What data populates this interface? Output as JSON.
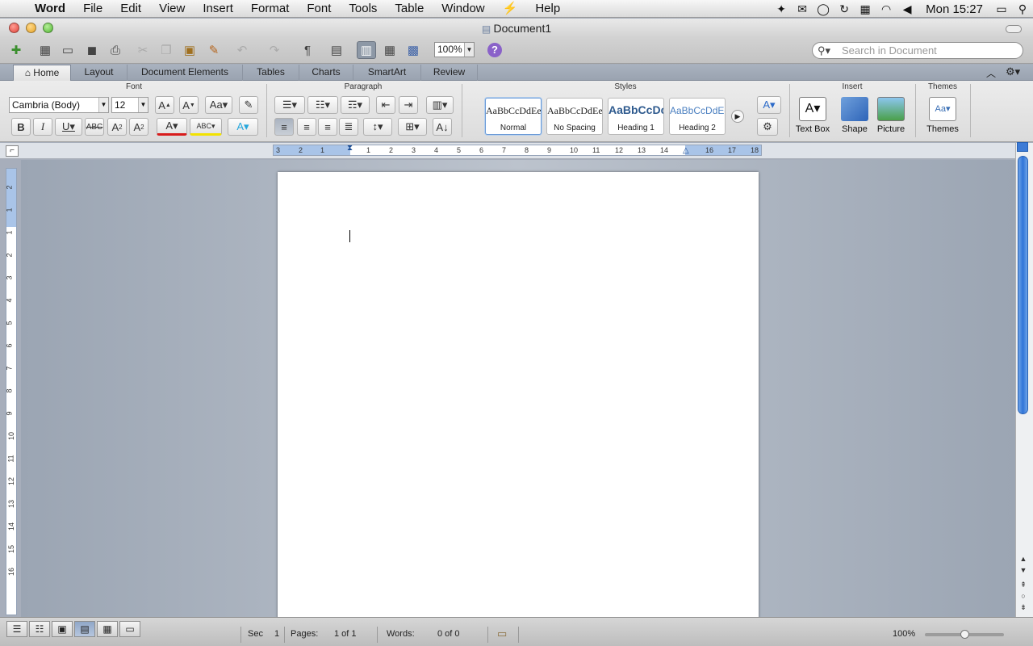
{
  "menubar": {
    "apple": "",
    "app": "Word",
    "items": [
      "File",
      "Edit",
      "View",
      "Insert",
      "Format",
      "Font",
      "Tools",
      "Table",
      "Window",
      "⚡",
      "Help"
    ],
    "clock": "Mon 15:27"
  },
  "window": {
    "title": "Document1"
  },
  "toolbar": {
    "zoom": "100%",
    "help": "?",
    "search_placeholder": "Search in Document"
  },
  "tabs": [
    "Home",
    "Layout",
    "Document Elements",
    "Tables",
    "Charts",
    "SmartArt",
    "Review"
  ],
  "ribbon": {
    "font": {
      "title": "Font",
      "name": "Cambria (Body)",
      "size": "12"
    },
    "paragraph": {
      "title": "Paragraph"
    },
    "styles": {
      "title": "Styles",
      "items": [
        {
          "preview": "AaBbCcDdEe",
          "name": "Normal"
        },
        {
          "preview": "AaBbCcDdEe",
          "name": "No Spacing"
        },
        {
          "preview": "AaBbCcDc",
          "name": "Heading 1"
        },
        {
          "preview": "AaBbCcDdEe",
          "name": "Heading 2"
        }
      ]
    },
    "insert": {
      "title": "Insert",
      "items": [
        "Text Box",
        "Shape",
        "Picture"
      ]
    },
    "themes": {
      "title": "Themes",
      "items": [
        "Themes"
      ]
    }
  },
  "ruler": {
    "h_ticks": [
      "3",
      "2",
      "1",
      "1",
      "2",
      "3",
      "4",
      "5",
      "6",
      "7",
      "8",
      "9",
      "10",
      "11",
      "12",
      "13",
      "14",
      "16",
      "17",
      "18"
    ],
    "v_ticks": [
      "2",
      "1",
      "1",
      "2",
      "3",
      "4",
      "5",
      "6",
      "7",
      "8",
      "9",
      "10",
      "11",
      "12",
      "13",
      "14",
      "15",
      "16"
    ]
  },
  "status": {
    "sec_label": "Sec",
    "sec_value": "1",
    "pages_label": "Pages:",
    "pages_value": "1 of 1",
    "words_label": "Words:",
    "words_value": "0 of 0",
    "zoom": "100%"
  }
}
